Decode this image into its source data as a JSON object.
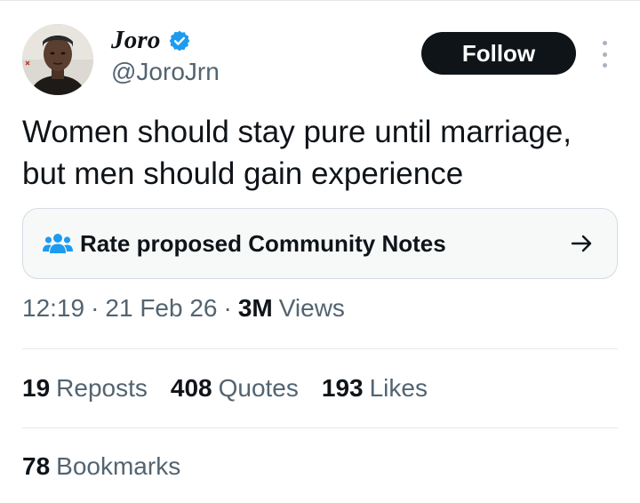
{
  "author": {
    "display_name": "Joro",
    "handle": "@JoroJrn",
    "verified_icon": "verified-badge-icon",
    "avatar_icon": "avatar"
  },
  "header": {
    "follow_label": "Follow",
    "more_icon": "more-options-icon"
  },
  "tweet": {
    "text": "Women should stay pure until marriage,\nbut men should gain experience"
  },
  "community_notes": {
    "label": "Rate proposed Community Notes",
    "icon": "people-icon",
    "arrow_icon": "arrow-right-icon"
  },
  "meta": {
    "time": "12:19",
    "separator": "·",
    "date": "21 Feb 26",
    "views_count": "3M",
    "views_label": "Views"
  },
  "stats": {
    "reposts_count": "19",
    "reposts_label": "Reposts",
    "quotes_count": "408",
    "quotes_label": "Quotes",
    "likes_count": "193",
    "likes_label": "Likes",
    "bookmarks_count": "78",
    "bookmarks_label": "Bookmarks"
  },
  "colors": {
    "accent_blue": "#1d9bf0",
    "text_primary": "#0f1419",
    "text_secondary": "#536471",
    "button_dark": "#0f1419",
    "divider": "#e6e9ec",
    "card_bg": "#f7f9f9",
    "notes_icon_blue": "#1d9bf0"
  }
}
